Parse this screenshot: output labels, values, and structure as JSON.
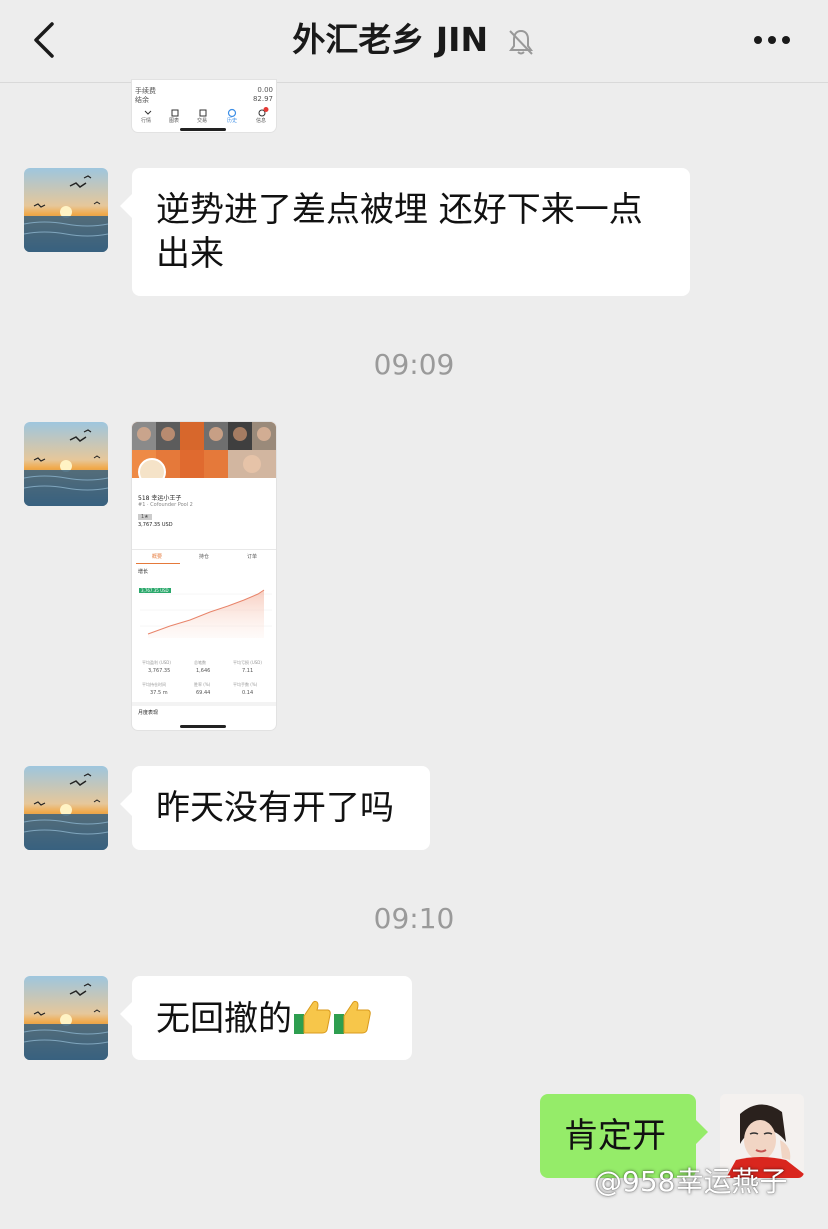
{
  "header": {
    "title": "外汇老乡 JIN",
    "back_icon": "chevron-left-icon",
    "mute_icon": "bell-muted-icon",
    "more_icon": "ellipsis-icon"
  },
  "image1": {
    "rows": [
      {
        "label": "手续费",
        "value": "0.00"
      },
      {
        "label": "结余",
        "value": "82.97"
      }
    ],
    "tabs": [
      "行情",
      "图表",
      "交易",
      "历史",
      "信息"
    ],
    "badge": "1"
  },
  "messages": [
    {
      "text": "逆势进了差点被埋 还好下来一点出来"
    },
    {
      "timestamp": "09:09"
    },
    {
      "text": "昨天没有开了吗"
    },
    {
      "timestamp": "09:10"
    },
    {
      "text": "无回撤的"
    },
    {
      "text": "肯定开"
    }
  ],
  "image2": {
    "name": "518 幸运小王子",
    "rank": "#1 · Cofounder Pool 2",
    "level": "1★",
    "equity": "3,767.35 USD",
    "tabs": [
      "概要",
      "持仓",
      "订单"
    ],
    "growth_label": "增长",
    "growth_badge": "3,767.35 USD",
    "stats": [
      {
        "label": "平均盈利 (USD)",
        "value": "3,767.35"
      },
      {
        "label": "总笔数",
        "value": "1,646"
      },
      {
        "label": "平均亏损 (USD)",
        "value": "7.11"
      },
      {
        "label": "平均持仓时间",
        "value": "37.5 m"
      },
      {
        "label": "胜率 (%)",
        "value": "69.44"
      },
      {
        "label": "平均手数 (%)",
        "value": "0.14"
      }
    ],
    "section": "月度表现"
  },
  "watermark": "@958幸运燕子"
}
